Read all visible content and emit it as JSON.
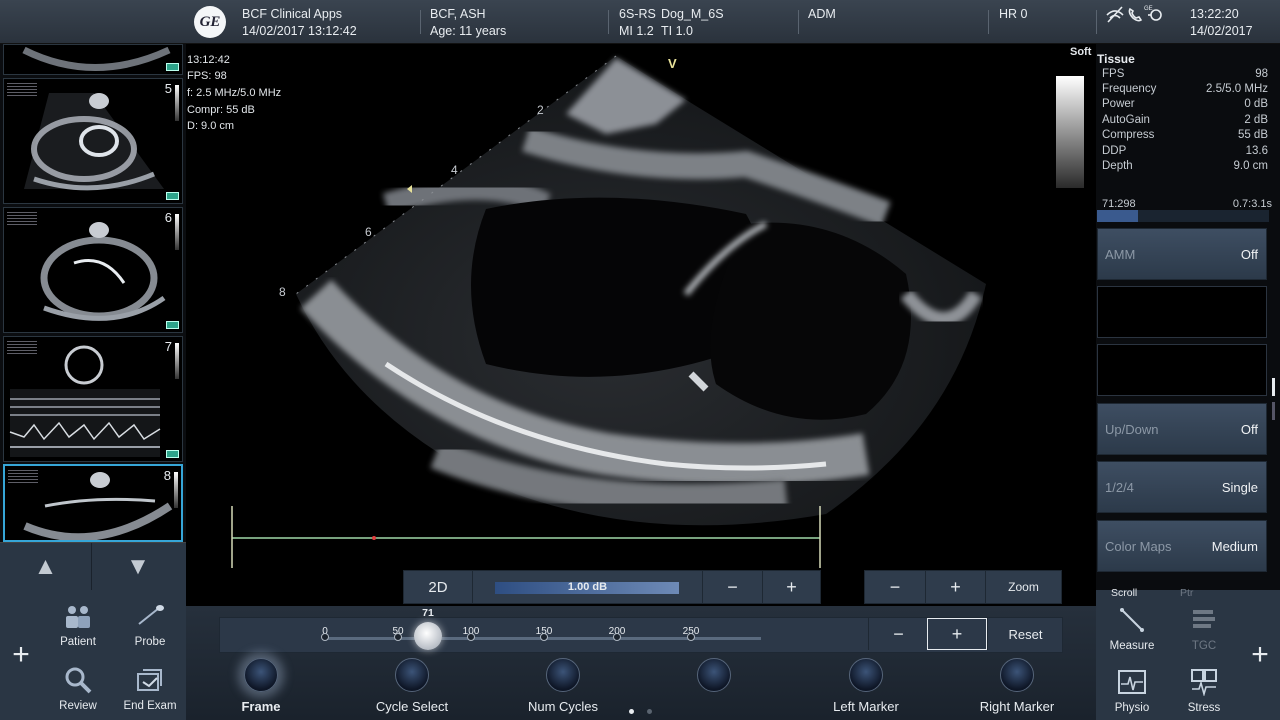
{
  "header": {
    "logo": "GE",
    "institution": "BCF Clinical Apps",
    "exam_datetime": "14/02/2017 13:12:42",
    "patient_name": "BCF, ASH",
    "patient_age": "Age: 11 years",
    "probe": "6S-RS",
    "preset": "Dog_M_6S",
    "mi": "MI 1.2",
    "ti": "TI 1.0",
    "operator": "ADM",
    "hr": "HR 0",
    "time": "13:22:20",
    "date": "14/02/2017",
    "status_icons": [
      "wifi-off-icon",
      "phone-icon",
      "network-icon"
    ]
  },
  "thumbnails": [
    {
      "number": ""
    },
    {
      "number": "5"
    },
    {
      "number": "6"
    },
    {
      "number": "7"
    },
    {
      "number": "8",
      "selected": true
    }
  ],
  "image_overlay": {
    "time": "13:12:42",
    "fps": "FPS: 98",
    "freq": "f: 2.5 MHz/5.0 MHz",
    "compress": "Compr: 55 dB",
    "depth": "D: 9.0 cm",
    "map_label": "Soft",
    "orientation_marker": "V",
    "depth_marks": [
      "2",
      "4",
      "6",
      "8"
    ]
  },
  "tissue_panel": {
    "title": "Tissue",
    "rows": [
      {
        "label": "FPS",
        "value": "98"
      },
      {
        "label": "Frequency",
        "value": "2.5/5.0 MHz"
      },
      {
        "label": "Power",
        "value": "0 dB"
      },
      {
        "label": "AutoGain",
        "value": "2 dB"
      },
      {
        "label": "Compress",
        "value": "55 dB"
      },
      {
        "label": "DDP",
        "value": "13.6"
      },
      {
        "label": "Depth",
        "value": "9.0 cm"
      }
    ],
    "cine_left": "71:298",
    "cine_right": "0.7:3.1s"
  },
  "right_buttons": {
    "amm": {
      "label": "AMM",
      "value": "Off"
    },
    "updown": {
      "label": "Up/Down",
      "value": "Off"
    },
    "layout": {
      "label": "1/2/4",
      "value": "Single"
    },
    "colormaps": {
      "label": "Color Maps",
      "value": "Medium"
    }
  },
  "right_tabs": {
    "scroll": "Scroll",
    "ptr": "Ptr"
  },
  "right_tools": {
    "measure": "Measure",
    "tgc": "TGC",
    "physio": "Physio",
    "stress": "Stress"
  },
  "left_tools": {
    "patient": "Patient",
    "probe": "Probe",
    "review": "Review",
    "end_exam": "End Exam"
  },
  "gain_bar": {
    "mode": "2D",
    "value": "1.00 dB",
    "minus": "−",
    "plus": "+"
  },
  "zoom_bar": {
    "minus": "−",
    "plus": "+",
    "label": "Zoom"
  },
  "frame_slider": {
    "current": "71",
    "current_value": 71,
    "ticks": [
      "0",
      "50",
      "100",
      "150",
      "200",
      "250"
    ],
    "minus": "−",
    "plus": "+",
    "reset": "Reset"
  },
  "knobs": [
    {
      "label": "Frame",
      "active": true
    },
    {
      "label": "Cycle Select"
    },
    {
      "label": "Num Cycles"
    },
    {
      "label": ""
    },
    {
      "label": "Left Marker"
    },
    {
      "label": "Right Marker"
    }
  ],
  "colors": {
    "accent": "#36a6d8",
    "marker_line": "#9fd8a8",
    "panel": "#2a3644"
  }
}
